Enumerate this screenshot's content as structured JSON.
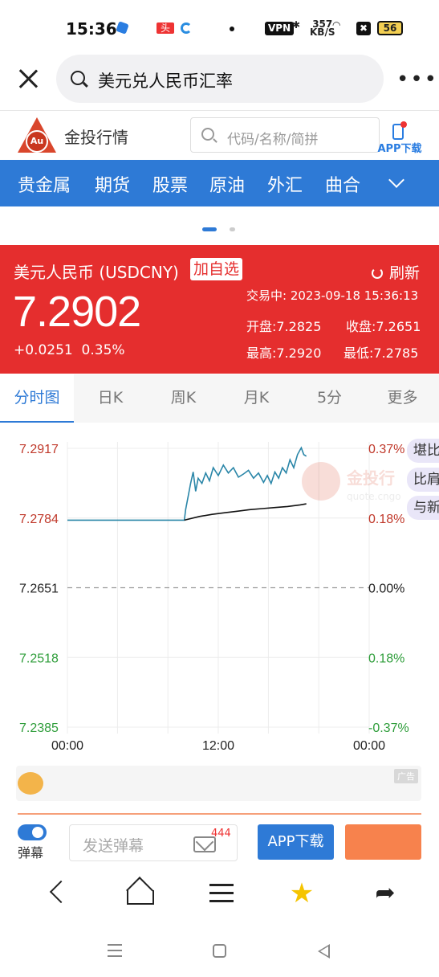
{
  "status_bar": {
    "time": "15:36",
    "badge_red": "头条",
    "vpn": "VPN",
    "speed_value": "357",
    "speed_unit": "KB/S",
    "battery": "56"
  },
  "search": {
    "query": "美元兑人民币汇率"
  },
  "site": {
    "logo_text": "Au",
    "name": "金投行情",
    "search_placeholder": "代码/名称/简拼",
    "app_download": "APP下载"
  },
  "nav": {
    "items": [
      "贵金属",
      "期货",
      "股票",
      "原油",
      "外汇",
      "曲合"
    ]
  },
  "quote": {
    "name": "美元人民币 (USDCNY)",
    "add_favorite": "加自选",
    "refresh": "刷新",
    "status": "交易中: 2023-09-18 15:36:13",
    "price": "7.2902",
    "change": "+0.0251",
    "change_pct": "0.35%",
    "open_label": "开盘:",
    "open": "7.2825",
    "prev_close_label": "收盘:",
    "prev_close": "7.2651",
    "high_label": "最高:",
    "high": "7.2920",
    "low_label": "最低:",
    "low": "7.2785"
  },
  "tabs": [
    "分时图",
    "日K",
    "周K",
    "月K",
    "5分",
    "更多"
  ],
  "chart_data": {
    "type": "line",
    "y_ticks_left": [
      "7.2917",
      "7.2784",
      "7.2651",
      "7.2518",
      "7.2385"
    ],
    "y_ticks_right": [
      "0.37%",
      "0.18%",
      "0.00%",
      "0.18%",
      "-0.37%"
    ],
    "x_ticks": [
      "00:00",
      "12:00",
      "00:00"
    ],
    "ylim": [
      7.2385,
      7.2917
    ],
    "baseline": 7.2651,
    "x_range_hours": [
      0,
      24
    ],
    "series": [
      {
        "x": [
          0,
          2,
          4,
          6,
          8,
          9.3,
          9.4,
          9.6,
          9.8,
          10,
          10.2,
          10.4,
          10.7,
          11,
          11.3,
          11.6,
          12,
          12.4,
          12.8,
          13.2,
          13.6,
          14,
          14.4,
          14.8,
          15.2,
          15.6,
          15.9,
          16.2,
          16.5,
          16.8,
          17.1,
          17.4,
          17.7,
          18,
          18.3,
          18.6,
          18.8,
          19.0
        ],
        "values": [
          7.278,
          7.278,
          7.278,
          7.278,
          7.278,
          7.278,
          7.28,
          7.2825,
          7.285,
          7.2872,
          7.2835,
          7.286,
          7.285,
          7.287,
          7.2855,
          7.288,
          7.2865,
          7.2885,
          7.287,
          7.288,
          7.2862,
          7.2868,
          7.2875,
          7.286,
          7.287,
          7.2852,
          7.2865,
          7.285,
          7.2872,
          7.286,
          7.288,
          7.287,
          7.2895,
          7.288,
          7.2905,
          7.2918,
          7.2905,
          7.2902
        ]
      },
      {
        "x": [
          9.3,
          10.5,
          11.5,
          12.5,
          13.5,
          14.5,
          15.5,
          16.5,
          17.5,
          18.5,
          19.0
        ],
        "values": [
          7.278,
          7.2787,
          7.2791,
          7.2794,
          7.2797,
          7.28,
          7.2802,
          7.2804,
          7.2806,
          7.2809,
          7.2811
        ]
      }
    ],
    "grid": true
  },
  "side_tags": [
    "堪比",
    "比肩",
    "与新"
  ],
  "watermark": {
    "title": "金投行",
    "url": "quote.cngo"
  },
  "ad": {
    "label": "广告"
  },
  "danmaku": {
    "toggle_label": "弹幕",
    "placeholder": "发送弹幕",
    "count": "444",
    "app_button": "APP下载"
  }
}
